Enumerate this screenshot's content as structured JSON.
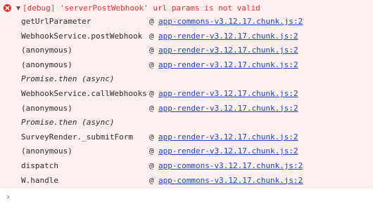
{
  "error": {
    "message": "[debug] 'serverPostWebhook' url params is not valid",
    "icon": "error-circle-icon",
    "toggle_icon": "caret-down-icon"
  },
  "stack": [
    {
      "fn": "getUrlParameter",
      "at": "@",
      "link": "app-commons-v3.12.17.chunk.js:2"
    },
    {
      "fn": "WebhookService.postWebhook",
      "at": "@",
      "link": "app-render-v3.12.17.chunk.js:2"
    },
    {
      "fn": "(anonymous)",
      "at": "@",
      "link": "app-render-v3.12.17.chunk.js:2"
    },
    {
      "fn": "(anonymous)",
      "at": "@",
      "link": "app-render-v3.12.17.chunk.js:2"
    },
    {
      "async": "Promise.then (async)"
    },
    {
      "fn": "WebhookService.callWebhooks",
      "at": "@",
      "link": "app-render-v3.12.17.chunk.js:2"
    },
    {
      "fn": "(anonymous)",
      "at": "@",
      "link": "app-render-v3.12.17.chunk.js:2"
    },
    {
      "async": "Promise.then (async)"
    },
    {
      "fn": "SurveyRender._submitForm",
      "at": "@",
      "link": "app-render-v3.12.17.chunk.js:2"
    },
    {
      "fn": "(anonymous)",
      "at": "@",
      "link": "app-render-v3.12.17.chunk.js:2"
    },
    {
      "fn": "dispatch",
      "at": "@",
      "link": "app-commons-v3.12.17.chunk.js:2"
    },
    {
      "fn": "W.handle",
      "at": "@",
      "link": "app-commons-v3.12.17.chunk.js:2"
    }
  ],
  "prompt": {
    "symbol": "›",
    "icon": "chevron-right-icon"
  },
  "colors": {
    "error_text": "#e8332b",
    "error_background": "#fff0f0",
    "link": "#1a44c9",
    "prompt": "#2a6fd6"
  }
}
